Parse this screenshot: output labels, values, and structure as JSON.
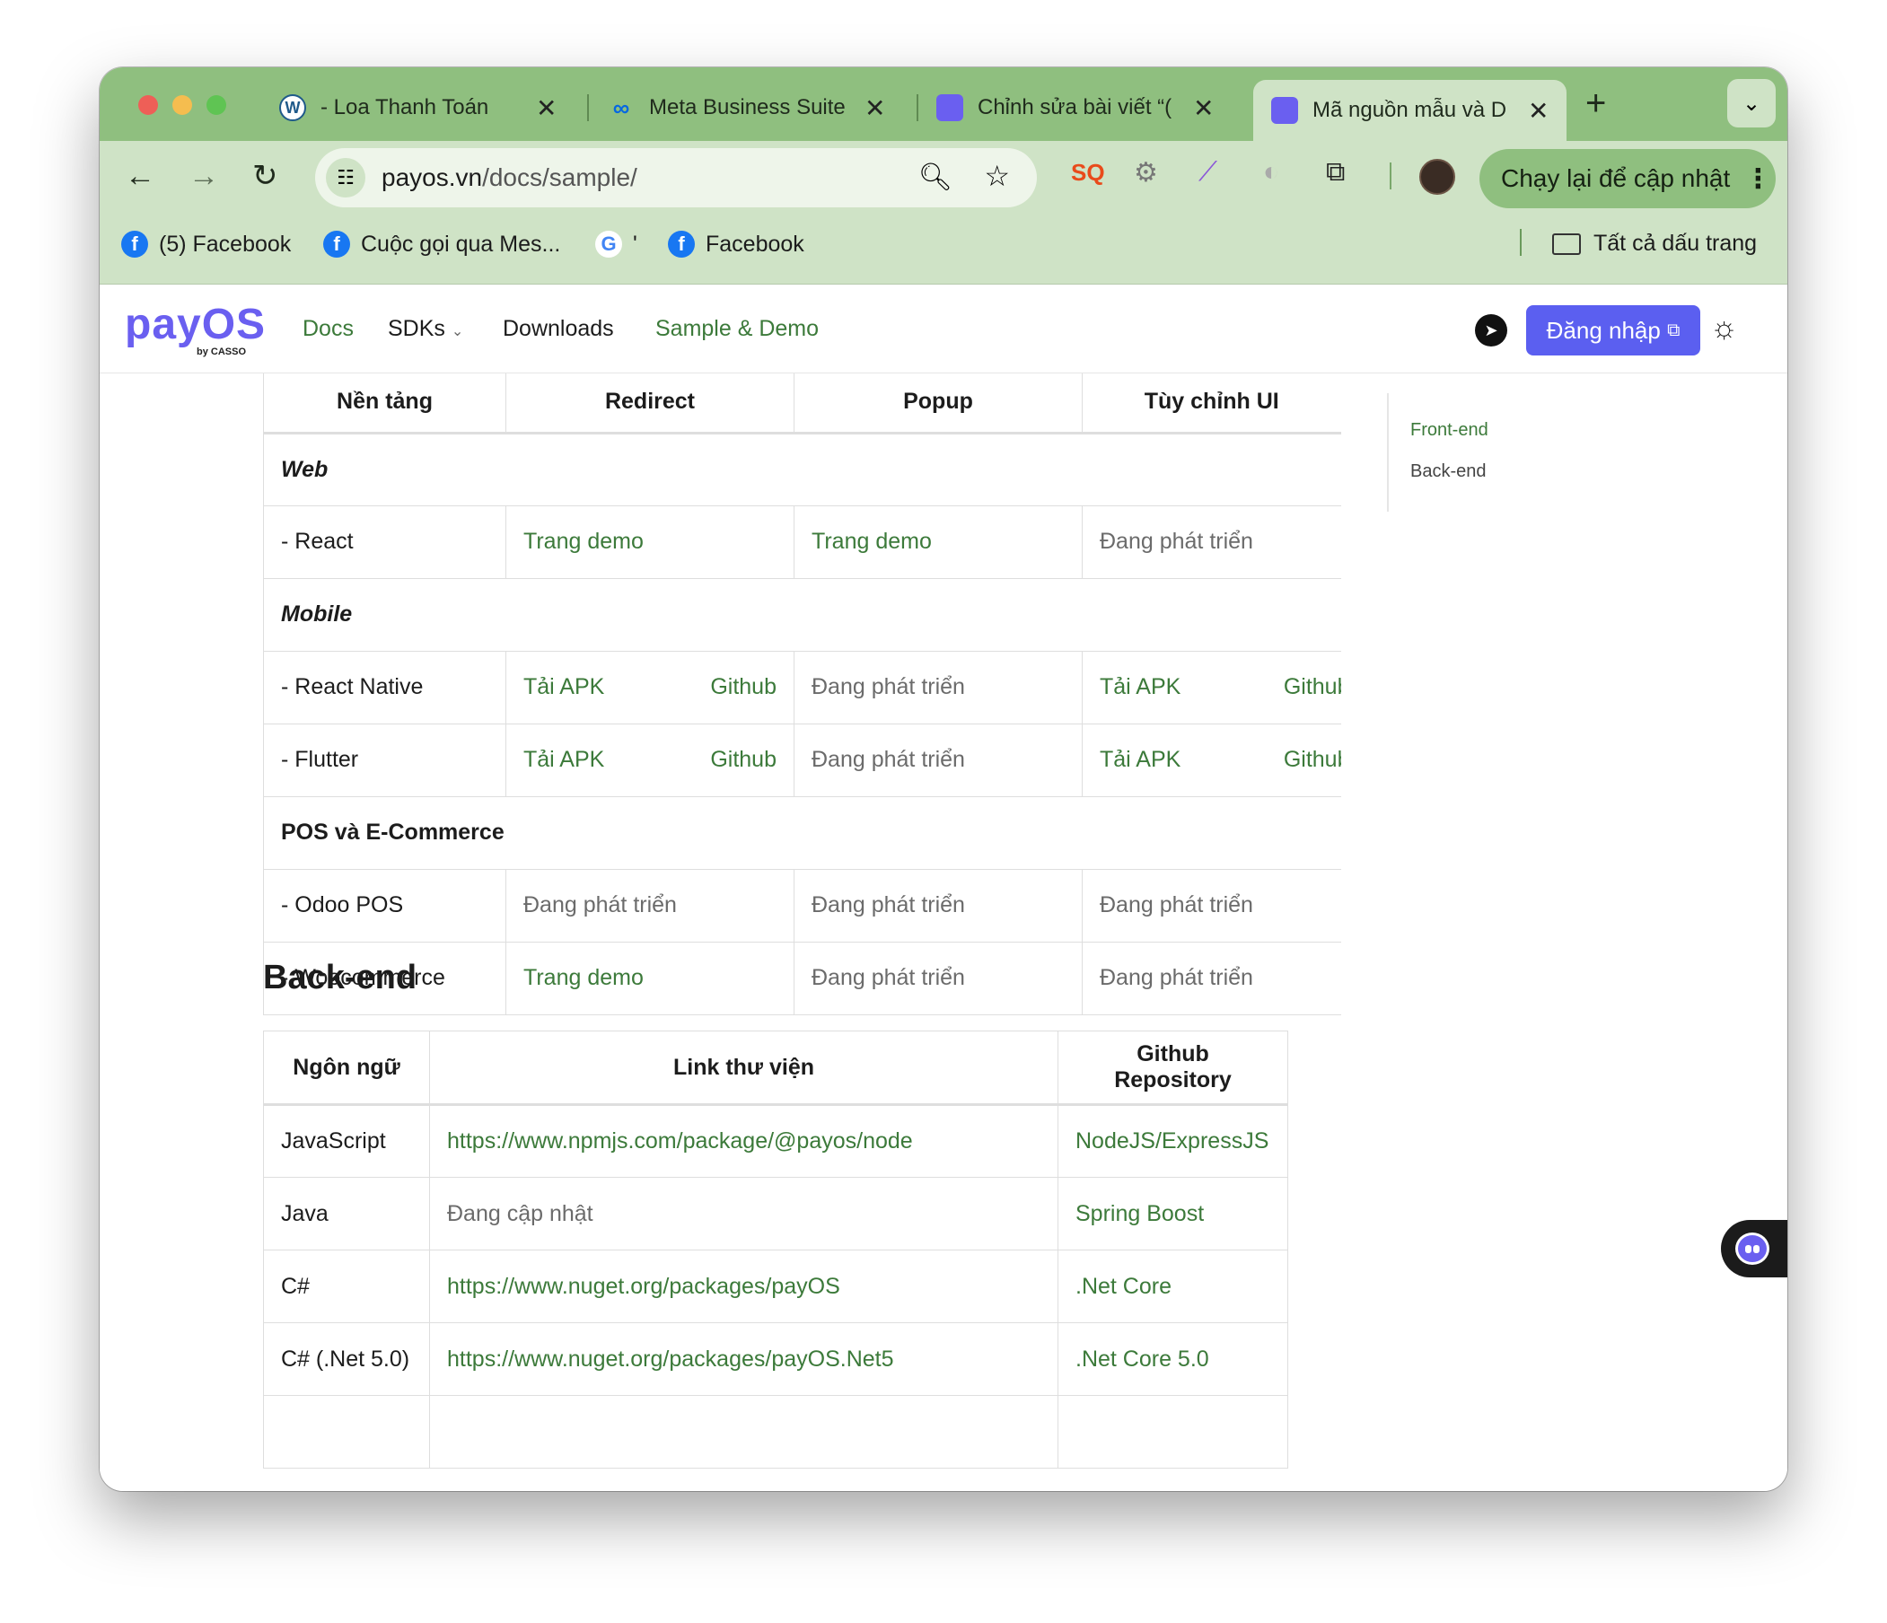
{
  "browser": {
    "tabs": [
      {
        "title": "- Loa Thanh Toán",
        "icon": "wordpress-icon"
      },
      {
        "title": "Meta Business Suite",
        "icon": "meta-icon"
      },
      {
        "title": "Chỉnh sửa bài viết “(",
        "icon": "square-icon"
      },
      {
        "title": "Mã nguồn mẫu và D",
        "icon": "square-icon",
        "active": true
      }
    ],
    "new_tab": "+",
    "url_host": "payos.vn",
    "url_path": "/docs/sample/",
    "update_button": "Chạy lại để cập nhật",
    "bookmarks": [
      "(5) Facebook",
      "Cuộc gọi qua Mes...",
      "'",
      "Facebook"
    ],
    "all_bookmarks": "Tất cả dấu trang"
  },
  "site": {
    "logo": "payOS",
    "logo_sub": "by CASSO",
    "nav": [
      "Docs",
      "SDKs",
      "Downloads",
      "Sample & Demo"
    ],
    "login": "Đăng nhập",
    "toc": [
      "Front-end",
      "Back-end"
    ]
  },
  "frontend_table": {
    "headers": [
      "Nền tảng",
      "Redirect",
      "Popup",
      "Tùy chỉnh UI"
    ],
    "sections": {
      "web": "Web",
      "mobile": "Mobile",
      "pos": "POS và E-Commerce"
    },
    "rows": {
      "react": [
        "- React",
        "Trang demo",
        "Trang demo",
        "Đang phát triển"
      ],
      "react_native": [
        "- React Native",
        "Tải APK",
        "Github",
        "Đang phát triển",
        "Tải APK",
        "Github"
      ],
      "flutter": [
        "- Flutter",
        "Tải APK",
        "Github",
        "Đang phát triển",
        "Tải APK",
        "Github"
      ],
      "odoo": [
        "- Odoo POS",
        "Đang phát triển",
        "Đang phát triển",
        "Đang phát triển"
      ],
      "woo": [
        "- Woocommerce",
        "Trang demo",
        "Đang phát triển",
        "Đang phát triển"
      ]
    }
  },
  "backend": {
    "heading": "Back-end",
    "headers": [
      "Ngôn ngữ",
      "Link thư viện",
      "Github Repository"
    ],
    "rows": [
      [
        "JavaScript",
        "https://www.npmjs.com/package/@payos/node",
        "NodeJS/ExpressJS"
      ],
      [
        "Java",
        "Đang cập nhật",
        "Spring Boost"
      ],
      [
        "C#",
        "https://www.nuget.org/packages/payOS",
        ".Net Core"
      ],
      [
        "C# (.Net 5.0)",
        "https://www.nuget.org/packages/payOS.Net5",
        ".Net Core 5.0"
      ]
    ]
  },
  "colors": {
    "accent": "#5b5ff0",
    "link_green": "#3c7a3a",
    "chrome_green": "#8fbf7f"
  }
}
